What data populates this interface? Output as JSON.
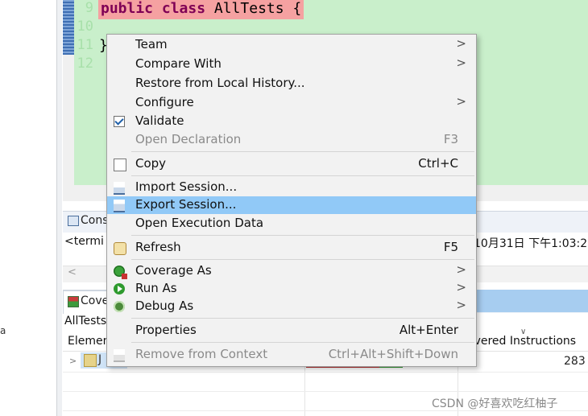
{
  "editor": {
    "line_numbers": [
      "9",
      "10",
      "11",
      "12"
    ],
    "line9_keywords": "public class",
    "line9_rest": " AllTests {",
    "line11_code": "}"
  },
  "console": {
    "tab_label": "Cons",
    "row_text": "<termi",
    "row_time": "10月31日 下午1:03:2",
    "scroll_left": "<"
  },
  "coverage": {
    "tab_label": "Cove",
    "title": "AllTests",
    "col_element": "Elemen",
    "col_covered": "overed Instructions",
    "sort_arrow": "∨",
    "row": {
      "expand": ">",
      "label": "J",
      "count": "283"
    }
  },
  "left_stray": "a",
  "context_menu": {
    "items": [
      {
        "label": "Team",
        "submenu": true,
        "icon": ""
      },
      {
        "label": "Compare With",
        "submenu": true,
        "icon": ""
      },
      {
        "label": "Restore from Local History...",
        "icon": ""
      },
      {
        "label": "Configure",
        "submenu": true,
        "icon": ""
      },
      {
        "label": "Validate",
        "icon": "checkbox-checked-icon"
      },
      {
        "label": "Open Declaration",
        "accelerator": "F3",
        "disabled": true,
        "icon": ""
      },
      {
        "label": "Copy",
        "accelerator": "Ctrl+C",
        "icon": "copy-icon"
      },
      {
        "label": "Import Session...",
        "icon": "import-session-icon"
      },
      {
        "label": "Export Session...",
        "highlighted": true,
        "icon": "export-session-icon"
      },
      {
        "label": "Open Execution Data",
        "icon": ""
      },
      {
        "label": "Refresh",
        "accelerator": "F5",
        "icon": "refresh-icon"
      },
      {
        "label": "Coverage As",
        "submenu": true,
        "icon": "coverage-as-icon"
      },
      {
        "label": "Run As",
        "submenu": true,
        "icon": "run-icon"
      },
      {
        "label": "Debug As",
        "submenu": true,
        "icon": "debug-icon"
      },
      {
        "label": "Properties",
        "accelerator": "Alt+Enter",
        "icon": ""
      },
      {
        "label": "Remove from Context",
        "accelerator": "Ctrl+Alt+Shift+Down",
        "disabled": true,
        "icon": "remove-context-icon"
      }
    ],
    "submenu_arrow": ">"
  },
  "watermark": "CSDN @好喜欢吃红柚子",
  "colors": {
    "editor_bg": "#c9efcb",
    "highlight_row": "#91c9f7",
    "error_line": "#f5a1a1",
    "keyword": "#7f0055"
  }
}
